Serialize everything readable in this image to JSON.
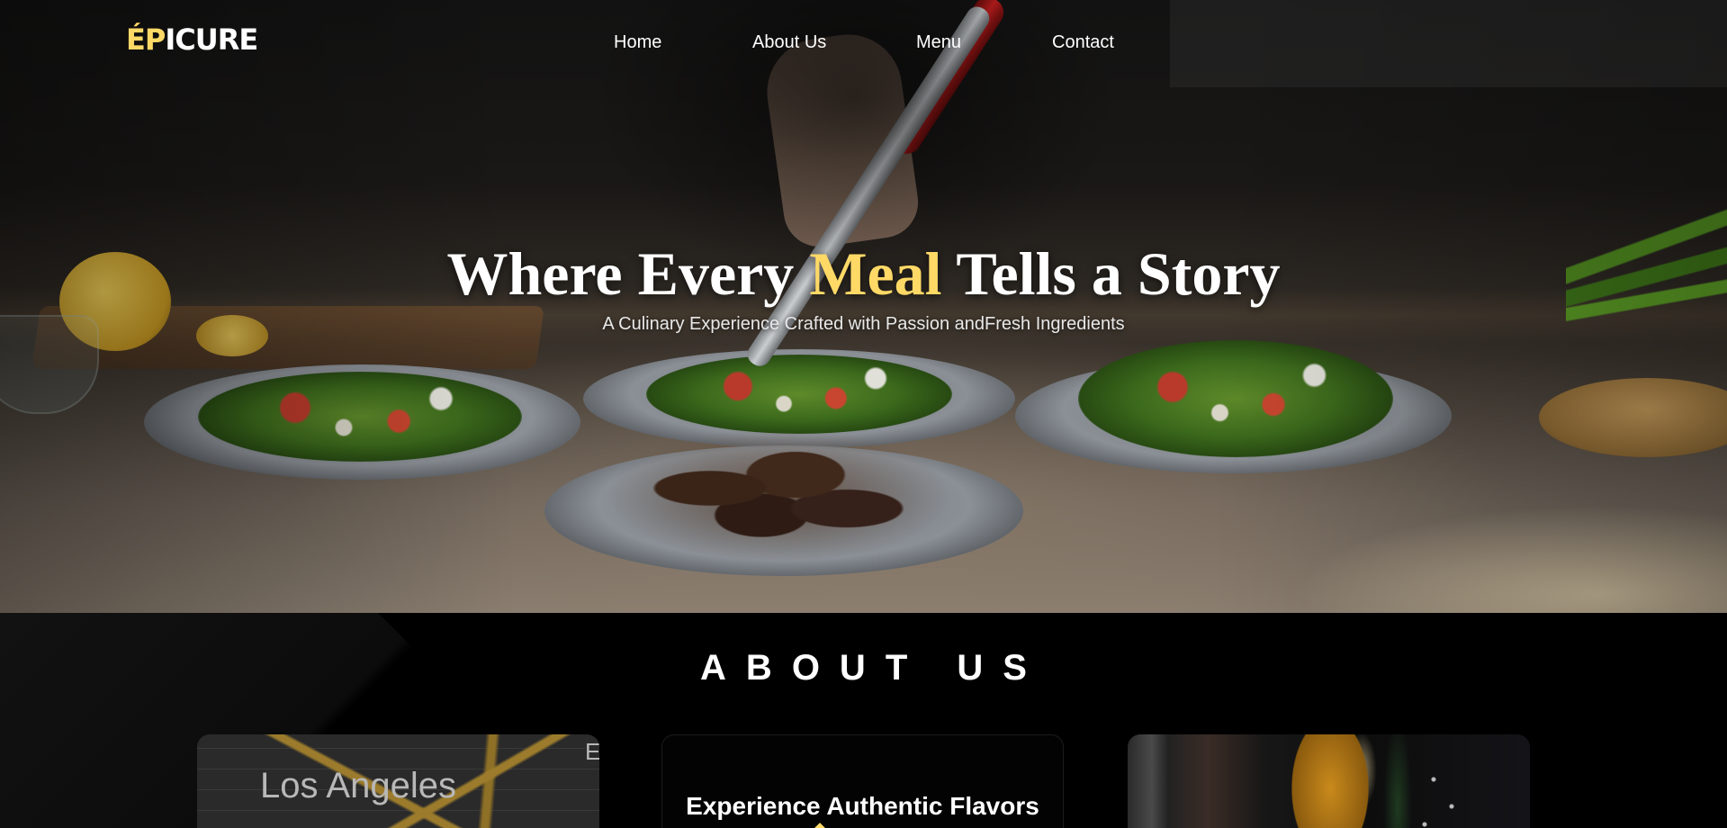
{
  "nav": {
    "logo_part1": "ÉP",
    "logo_part2": "ICURE",
    "links": [
      {
        "label": "Home"
      },
      {
        "label": "About Us"
      },
      {
        "label": "Menu"
      },
      {
        "label": "Contact"
      }
    ]
  },
  "hero": {
    "title_before": "Where Every ",
    "title_accent": "Meal",
    "title_after": " Tells a Story",
    "subtitle": "A Culinary Experience Crafted with Passion andFresh Ingredients"
  },
  "about": {
    "title": "ABOUT US",
    "map_city": "Los Angeles",
    "map_edge_letter": "E",
    "card_title": "Experience Authentic Flavors"
  },
  "colors": {
    "accent": "#ffd966",
    "background": "#000000",
    "text": "#ffffff"
  }
}
